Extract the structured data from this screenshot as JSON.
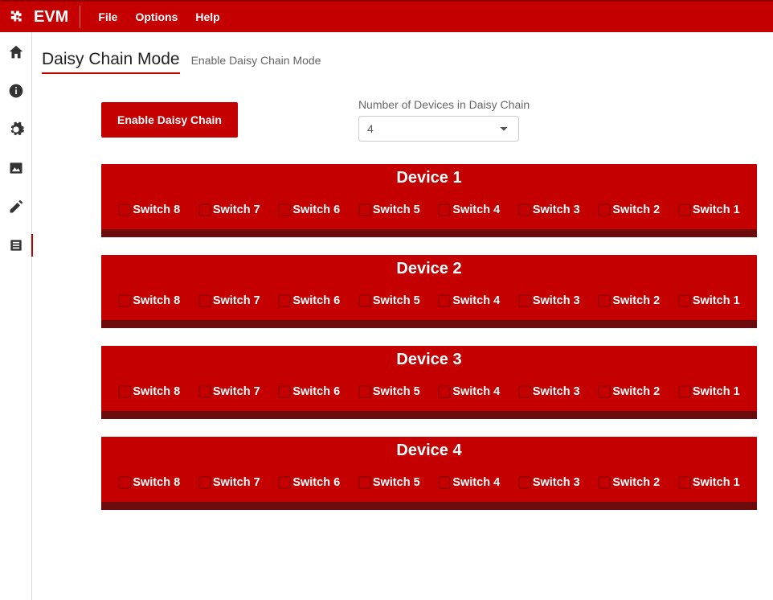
{
  "header": {
    "brand": "EVM",
    "menu": [
      "File",
      "Options",
      "Help"
    ]
  },
  "sidenav": {
    "items": [
      {
        "name": "home-icon",
        "active": false
      },
      {
        "name": "info-icon",
        "active": false
      },
      {
        "name": "gear-icon",
        "active": false
      },
      {
        "name": "image-icon",
        "active": false
      },
      {
        "name": "edit-icon",
        "active": false
      },
      {
        "name": "list-icon",
        "active": true
      }
    ]
  },
  "page": {
    "title": "Daisy Chain Mode",
    "subtitle": "Enable Daisy Chain Mode"
  },
  "controls": {
    "enable_btn": "Enable Daisy Chain",
    "numdev_label": "Number of Devices in Daisy Chain",
    "numdev_value": "4"
  },
  "devices": [
    {
      "title": "Device 1",
      "switches": [
        "Switch 8",
        "Switch 7",
        "Switch 6",
        "Switch 5",
        "Switch 4",
        "Switch 3",
        "Switch 2",
        "Switch 1"
      ]
    },
    {
      "title": "Device 2",
      "switches": [
        "Switch 8",
        "Switch 7",
        "Switch 6",
        "Switch 5",
        "Switch 4",
        "Switch 3",
        "Switch 2",
        "Switch 1"
      ]
    },
    {
      "title": "Device 3",
      "switches": [
        "Switch 8",
        "Switch 7",
        "Switch 6",
        "Switch 5",
        "Switch 4",
        "Switch 3",
        "Switch 2",
        "Switch 1"
      ]
    },
    {
      "title": "Device 4",
      "switches": [
        "Switch 8",
        "Switch 7",
        "Switch 6",
        "Switch 5",
        "Switch 4",
        "Switch 3",
        "Switch 2",
        "Switch 1"
      ]
    }
  ]
}
